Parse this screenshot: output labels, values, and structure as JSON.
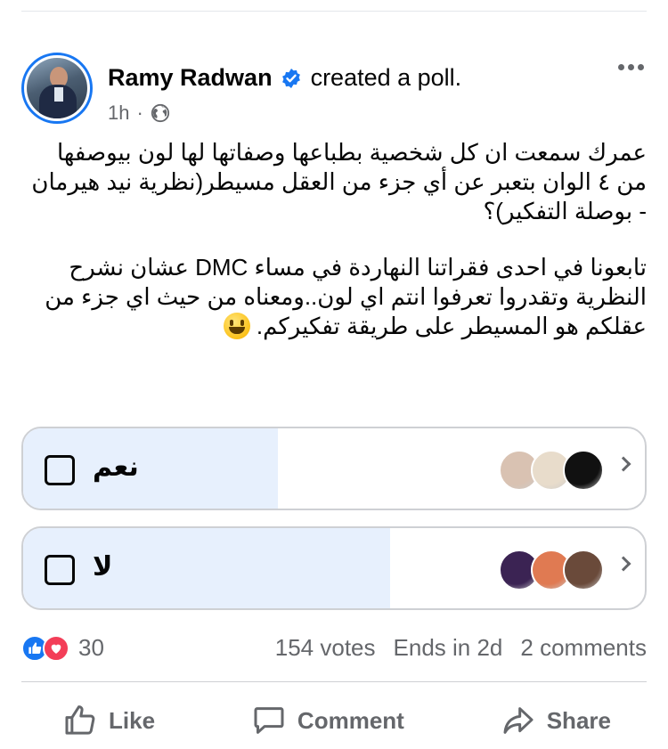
{
  "post": {
    "author": "Ramy Radwan",
    "action": "created a poll.",
    "time": "1h",
    "separator": "·",
    "body_p1": "عمرك سمعت ان كل شخصية بطباعها وصفاتها لها لون بيوصفها من ٤ الوان بتعبر عن أي جزء من العقل مسيطر(نظرية نيد هيرمان - بوصلة التفكير)؟",
    "body_p2": "تابعونا في احدى فقراتنا النهاردة في مساء DMC عشان نشرح النظرية وتقدروا تعرفوا انتم اي لون..ومعناه من حيث اي جزء من عقلكم هو المسيطر على طريقة تفكيركم."
  },
  "poll": {
    "options": [
      {
        "label": "نعم",
        "share": 0.41,
        "voter_colors": [
          "#111111",
          "#e8dccb",
          "#d9c2b2"
        ]
      },
      {
        "label": "لا",
        "share": 0.59,
        "voter_colors": [
          "#6a4a3a",
          "#e07a52",
          "#3b2353"
        ]
      }
    ]
  },
  "stats": {
    "reactions_count": "30",
    "votes": "154 votes",
    "ends": "Ends in 2d",
    "comments": "2 comments"
  },
  "actions": {
    "like": "Like",
    "comment": "Comment",
    "share": "Share"
  },
  "colors": {
    "accent": "#1877f2",
    "poll_fill": "#e7f0fd",
    "secondary_text": "#65676b"
  }
}
